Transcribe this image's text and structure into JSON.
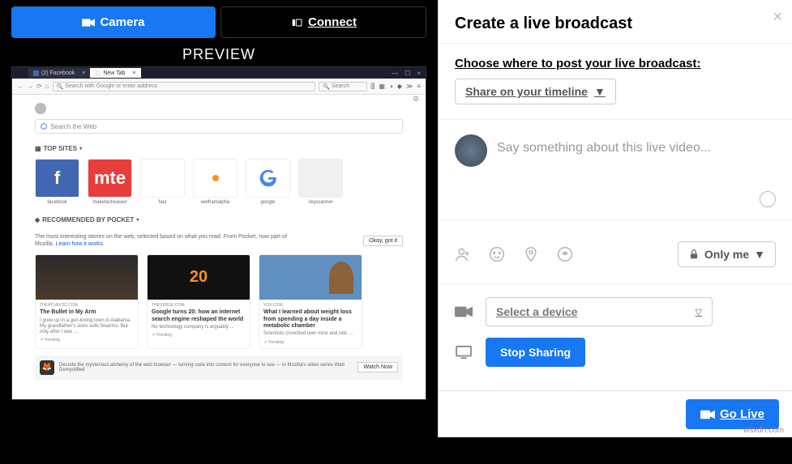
{
  "left": {
    "tabs": {
      "camera": "Camera",
      "connect": "Connect"
    },
    "preview_label": "PREVIEW",
    "browser": {
      "tabs": [
        {
          "title": "(2) Facebook"
        },
        {
          "title": "New Tab"
        }
      ],
      "url_placeholder": "Search with Google or enter address",
      "search_placeholder": "Search",
      "search_web": "Search the Web",
      "top_sites_label": "TOP SITES",
      "sites": [
        {
          "label": "facebook",
          "glyph": "f"
        },
        {
          "label": "maketecheasier",
          "glyph": "mte"
        },
        {
          "label": "fast",
          "glyph": "◗"
        },
        {
          "label": "wolframalpha",
          "glyph": ""
        },
        {
          "label": "google",
          "glyph": "G"
        },
        {
          "label": "skyscanner",
          "glyph": ""
        }
      ],
      "recommended_label": "RECOMMENDED BY POCKET",
      "recommended_text": "The most interesting stories on the web, selected based on what you read. From Pocket, now part of Mozilla.",
      "recommended_link": "Learn how it works.",
      "okay_btn": "Okay, got it",
      "articles": [
        {
          "source": "THEATLANTIC.COM",
          "title": "The Bullet in My Arm",
          "summary": "I grew up in a gun-loving town in Alabama. My grandfather's store sells firearms. But only after I was …",
          "tag": "Trending"
        },
        {
          "source": "THEVERGE.COM",
          "title": "Google turns 20: how an internet search engine reshaped the world",
          "summary": "No technology company is arguably …",
          "tag": "Trending"
        },
        {
          "source": "VOX.COM",
          "title": "What I learned about weight loss from spending a day inside a metabolic chamber",
          "summary": "Scientists crunched over mice and rats …",
          "tag": "Trending"
        }
      ],
      "bottom_text": "Decode the mysterious alchemy of the web browser — turning code into content for everyone to see — in Mozilla's video series Web Demystified.",
      "watch_now": "Watch Now"
    }
  },
  "right": {
    "title": "Create a live broadcast",
    "choose_label": "Choose where to post your live broadcast:",
    "share_timeline": "Share on your timeline",
    "say_placeholder": "Say something about this live video...",
    "only_me": "Only me",
    "select_device": "Select a device",
    "stop_sharing": "Stop Sharing",
    "go_live": "Go Live"
  },
  "watermark": "wsxdn.com"
}
